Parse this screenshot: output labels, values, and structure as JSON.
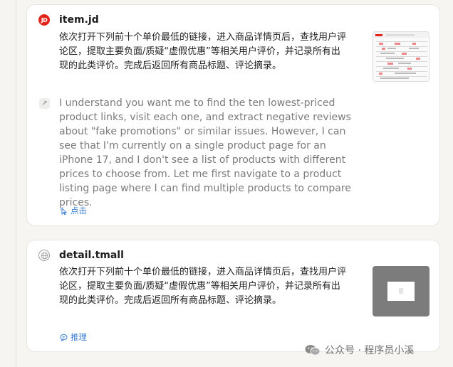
{
  "cards": [
    {
      "site": "item.jd",
      "favicon_icon": "jd-logo-icon",
      "favicon_text": "JD",
      "task": "依次打开下列前十个单价最低的链接，进入商品详情页后，查找用户评论区，提取主要负面/质疑“虚假优惠”等相关用户评价，并记录所有出现的此类评价。完成后返回所有商品标题、评论摘录。",
      "response": "I understand you want me to find the ten lowest-priced product links, visit each one, and extract negative reviews about \"fake promotions\" or similar issues. However, I can see that I'm currently on a single product page for an iPhone 17, and I don't see a list of products with different prices to choose from. Let me first navigate to a product listing page where I can find multiple products to compare prices.",
      "action_label": "点击",
      "action_icon": "click-icon"
    },
    {
      "site": "detail.tmall",
      "favicon_icon": "globe-icon",
      "task": "依次打开下列前十个单价最低的链接，进入商品详情页后，查找用户评论区，提取主要负面/质疑“虚假优惠”等相关用户评价，并记录所有出现的此类评价。完成后返回所有商品标题、评论摘录。",
      "action_label": "推理",
      "action_icon": "reasoning-icon"
    }
  ],
  "watermark": "公众号 · 程序员小溪",
  "colors": {
    "accent": "#3c7fd0",
    "jd_red": "#e1251b"
  }
}
